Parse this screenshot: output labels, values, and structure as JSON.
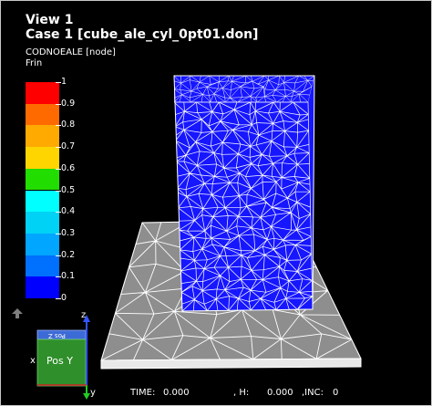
{
  "viewport": {
    "view_title": "View 1",
    "case_title": "Case 1  [cube_ale_cyl_0pt01.don]",
    "variable": "CODNOEALE [node]",
    "field": "Frin"
  },
  "legend": {
    "ticks": [
      "1",
      "0.9",
      "0.8",
      "0.7",
      "0.6",
      "0.5",
      "0.4",
      "0.3",
      "0.2",
      "0.1",
      "0"
    ],
    "colors": [
      "#ff0000",
      "#ff6a00",
      "#ffaa00",
      "#ffd500",
      "#22dd00",
      "#00ffff",
      "#00d2f5",
      "#00a6ff",
      "#0070ff",
      "#0000ff"
    ]
  },
  "triad": {
    "z_label": "z",
    "x_label": "x",
    "y_label": "y",
    "top_face": "Pos Z",
    "front_face": "Pos Y"
  },
  "status": {
    "time_label": "TIME:",
    "time_value": "0.000",
    "h_label": ", H:",
    "h_value": "0.000",
    "inc_label": ",INC:",
    "inc_value": "0"
  },
  "colors": {
    "mesh_blue": "#1616ff",
    "plate_gray": "#8e8e8e",
    "background": "#000000"
  }
}
